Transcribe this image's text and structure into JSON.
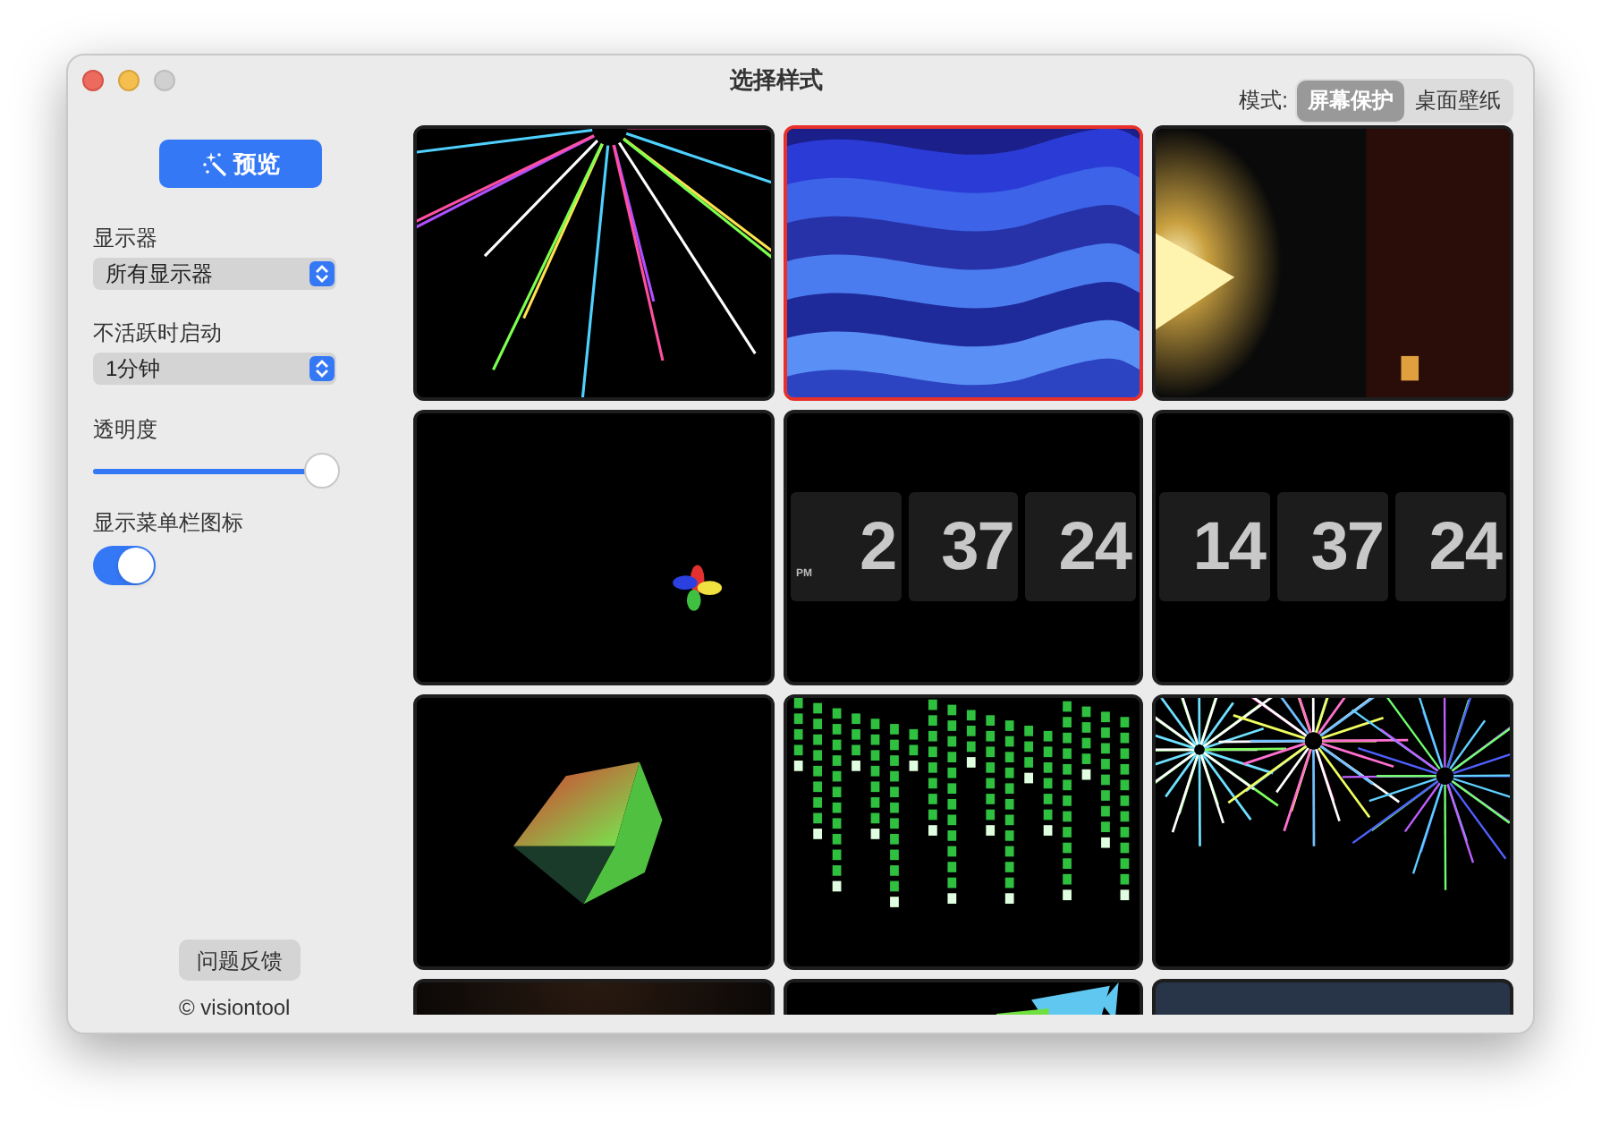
{
  "window": {
    "title": "选择样式"
  },
  "mode": {
    "label": "模式:",
    "segments": [
      {
        "label": "屏幕保护",
        "selected": true
      },
      {
        "label": "桌面壁纸",
        "selected": false
      }
    ]
  },
  "sidebar": {
    "preview_button": "预览",
    "display": {
      "label": "显示器",
      "value": "所有显示器"
    },
    "idle_start": {
      "label": "不活跃时启动",
      "value": "1分钟"
    },
    "opacity": {
      "label": "透明度",
      "level": 1
    },
    "menu_bar_icon": {
      "label": "显示菜单栏图标",
      "on": true
    },
    "feedback_button": "问题反馈",
    "copyright": "© visiontool"
  },
  "thumbnails": [
    {
      "kind": "picture",
      "selected": false
    },
    {
      "kind": "picture",
      "selected": true
    },
    {
      "kind": "picture",
      "selected": false
    },
    {
      "kind": "picture",
      "selected": false
    },
    {
      "kind": "flip_clock",
      "selected": false,
      "meridiem": "PM",
      "digits": [
        "2",
        "37",
        "24"
      ]
    },
    {
      "kind": "flip_clock",
      "selected": false,
      "digits": [
        "14",
        "37",
        "24"
      ]
    },
    {
      "kind": "picture",
      "selected": false
    },
    {
      "kind": "picture",
      "selected": false
    },
    {
      "kind": "picture",
      "selected": false
    },
    {
      "kind": "picture",
      "selected": false
    },
    {
      "kind": "picture",
      "selected": false
    },
    {
      "kind": "picture",
      "selected": false
    }
  ]
}
